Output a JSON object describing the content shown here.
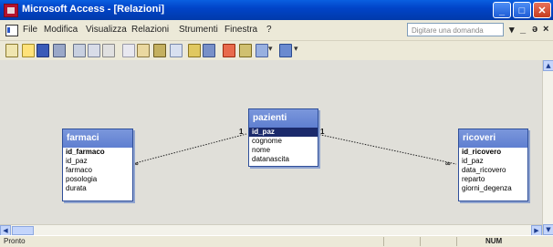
{
  "window": {
    "title": "Microsoft Access - [Relazioni]",
    "buttons": [
      "minimize",
      "maximize",
      "close"
    ]
  },
  "menubar": {
    "items": [
      "File",
      "Modifica",
      "Visualizza",
      "Relazioni",
      "Strumenti",
      "Finestra",
      "?"
    ],
    "help_placeholder": "Digitare una domanda",
    "mdi_controls": [
      "▾",
      "_",
      "ə",
      "×"
    ]
  },
  "toolbar": {
    "icons": [
      "report-view-icon",
      "save-icon",
      "print-icon",
      "print-preview-icon",
      "spelling-icon",
      "cut-icon",
      "copy-icon",
      "paste-icon",
      "format-painter-icon",
      "undo-icon",
      "show-table-icon",
      "show-direct-icon",
      "delete-icon",
      "database-window-icon",
      "new-object-icon",
      "help-icon"
    ]
  },
  "tables": [
    {
      "name": "farmaci",
      "fields": [
        "id_farmaco",
        "id_paz",
        "farmaco",
        "posologia",
        "durata"
      ],
      "key_index": 0
    },
    {
      "name": "pazienti",
      "fields": [
        "id_paz",
        "cognome",
        "nome",
        "datanascita"
      ],
      "key_index": 0,
      "selected_index": 0
    },
    {
      "name": "ricoveri",
      "fields": [
        "id_ricovero",
        "id_paz",
        "data_ricovero",
        "reparto",
        "giorni_degenza"
      ],
      "key_index": 0
    }
  ],
  "relationships": [
    {
      "from": "farmaci",
      "to": "pazienti",
      "from_label": "∞",
      "to_label": "1"
    },
    {
      "from": "pazienti",
      "to": "ricoveri",
      "from_label": "1",
      "to_label": "∞"
    }
  ],
  "statusbar": {
    "ready": "Pronto",
    "num": "NUM"
  },
  "colors": {
    "title_bar": "#0144c8",
    "table_header": "#6b8ad6",
    "workspace": "#e0dfd9",
    "selection": "#1b2a6b"
  }
}
